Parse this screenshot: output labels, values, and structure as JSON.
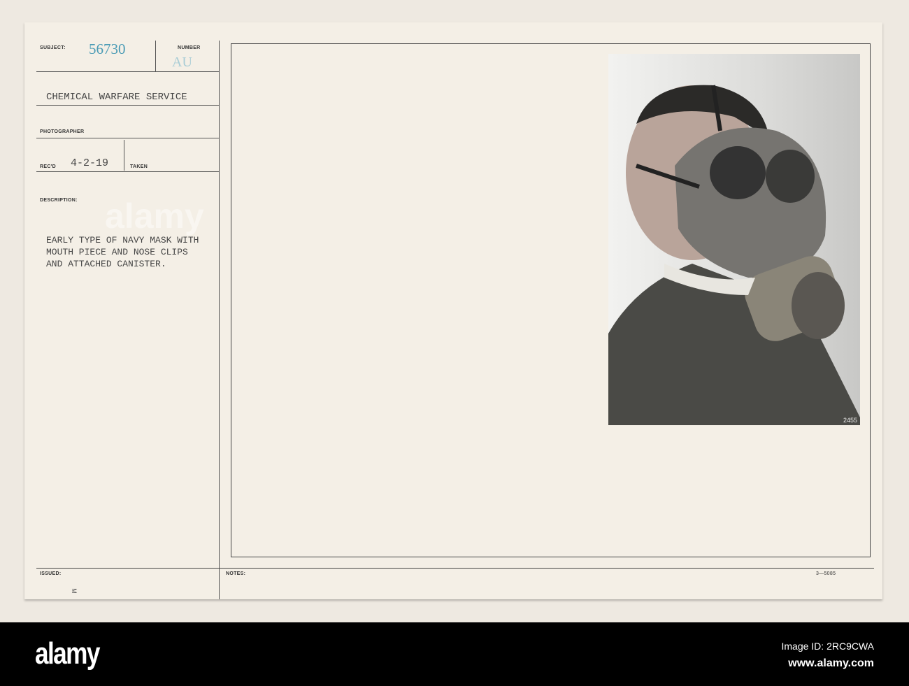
{
  "card": {
    "subject_label": "SUBJECT:",
    "subject_number": "56730",
    "number_label": "NUMBER",
    "number_value": "AU",
    "service": "CHEMICAL WARFARE SERVICE",
    "photographer_label": "PHOTOGRAPHER",
    "recd_label": "REC'D",
    "recd_date": "4-2-19",
    "taken_label": "TAKEN",
    "description_label": "DESCRIPTION:",
    "description": "EARLY TYPE OF NAVY MASK WITH\nMOUTH PIECE AND NOSE CLIPS\nAND ATTACHED CANISTER.",
    "issued_label": "ISSUED:",
    "issued_mark": "M",
    "notes_label": "NOTES:",
    "form_code": "3—5085",
    "photo_number": "2455"
  },
  "footer": {
    "logo": "alamy",
    "image_id": "Image ID: 2RC9CWA",
    "url": "www.alamy.com"
  },
  "colors": {
    "stamp_blue": "#4a9bb5",
    "paper": "#f4efe6"
  }
}
